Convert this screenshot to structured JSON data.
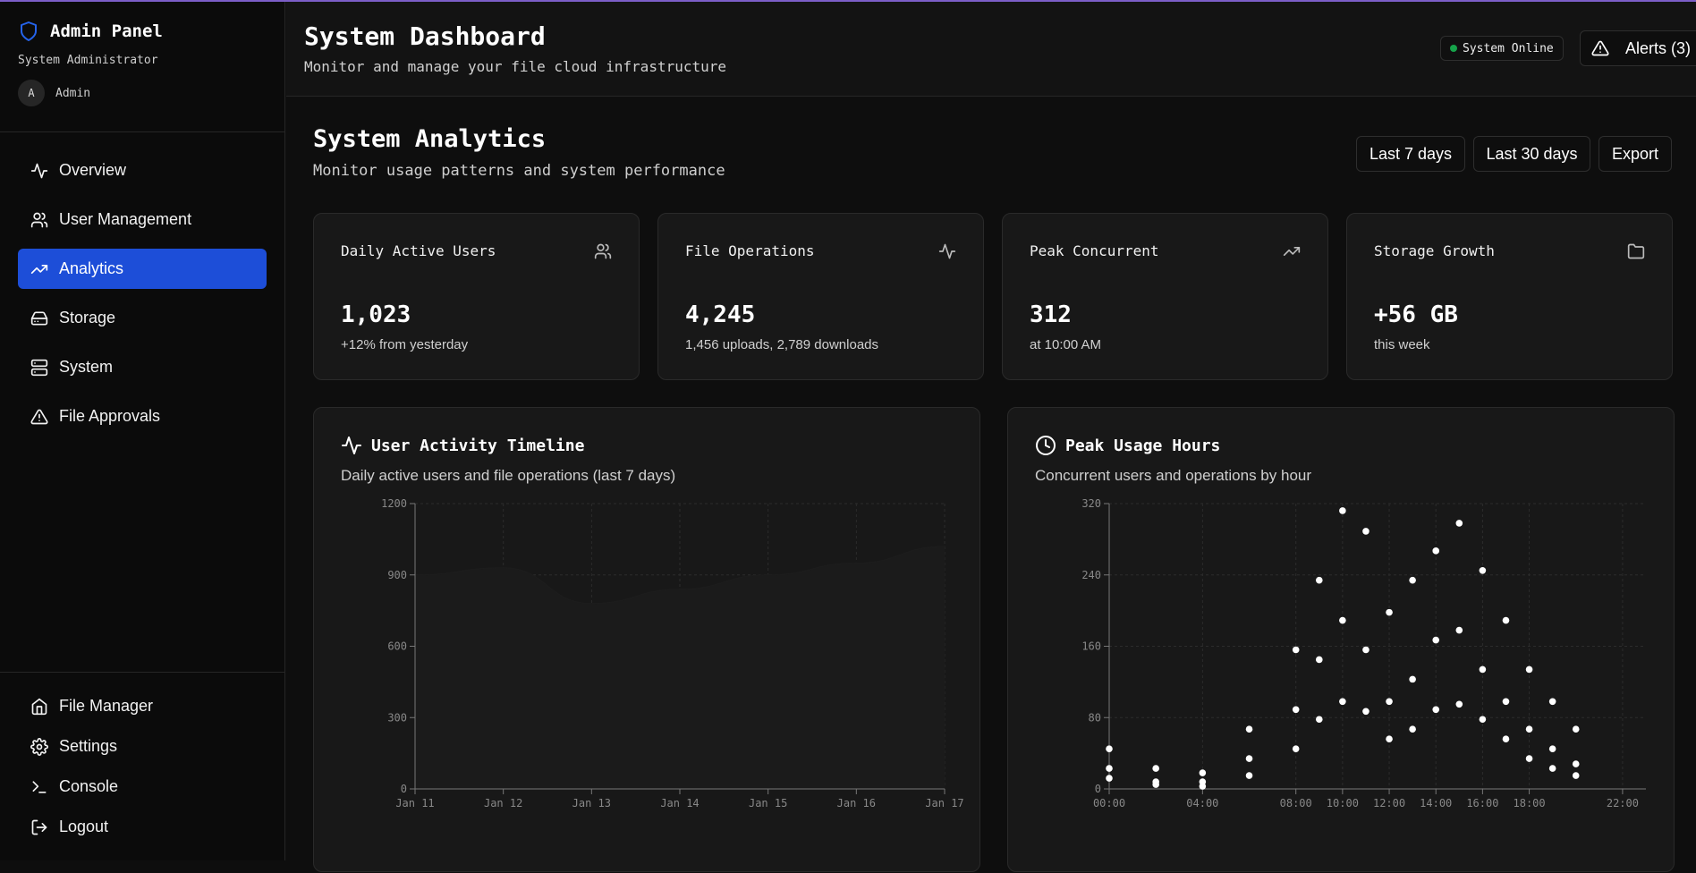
{
  "sidebar": {
    "brand_title": "Admin Panel",
    "brand_subtitle": "System Administrator",
    "avatar_initial": "A",
    "user_name": "Admin",
    "nav": [
      {
        "label": "Overview",
        "icon": "activity-icon"
      },
      {
        "label": "User Management",
        "icon": "users-icon"
      },
      {
        "label": "Analytics",
        "icon": "trending-up-icon",
        "active": true
      },
      {
        "label": "Storage",
        "icon": "hard-drive-icon"
      },
      {
        "label": "System",
        "icon": "server-icon"
      },
      {
        "label": "File Approvals",
        "icon": "alert-triangle-icon"
      }
    ],
    "bottom_nav": [
      {
        "label": "File Manager",
        "icon": "home-icon"
      },
      {
        "label": "Settings",
        "icon": "gear-icon"
      },
      {
        "label": "Console",
        "icon": "terminal-icon"
      },
      {
        "label": "Logout",
        "icon": "logout-icon"
      }
    ]
  },
  "header": {
    "title": "System Dashboard",
    "subtitle": "Monitor and manage your file cloud infrastructure",
    "status": "System Online",
    "alerts_label": "Alerts (3)"
  },
  "analytics": {
    "title": "System Analytics",
    "subtitle": "Monitor usage patterns and system performance",
    "buttons": {
      "last7": "Last 7 days",
      "last30": "Last 30 days",
      "export": "Export"
    }
  },
  "stats": [
    {
      "title": "Daily Active Users",
      "value": "1,023",
      "note": "+12% from yesterday",
      "icon": "users-icon"
    },
    {
      "title": "File Operations",
      "value": "4,245",
      "note": "1,456 uploads, 2,789 downloads",
      "icon": "activity-icon"
    },
    {
      "title": "Peak Concurrent",
      "value": "312",
      "note": "at 10:00 AM",
      "icon": "trending-up-icon"
    },
    {
      "title": "Storage Growth",
      "value": "+56 GB",
      "note": "this week",
      "icon": "folder-icon"
    }
  ],
  "colors": {
    "accent": "#1d4ed8",
    "online": "#16a34a",
    "top_border": "#7c5ec7"
  },
  "chart_data": [
    {
      "type": "area",
      "title": "User Activity Timeline",
      "subtitle": "Daily active users and file operations (last 7 days)",
      "categories": [
        "Jan 11",
        "Jan 12",
        "Jan 13",
        "Jan 14",
        "Jan 15",
        "Jan 16",
        "Jan 17"
      ],
      "series": [
        {
          "values": [
            900,
            930,
            780,
            840,
            900,
            950,
            1020
          ]
        }
      ],
      "ylim": [
        0,
        1200
      ],
      "yticks": [
        0,
        300,
        600,
        900,
        1200
      ],
      "grid": true
    },
    {
      "type": "scatter",
      "title": "Peak Usage Hours",
      "subtitle": "Concurrent users and operations by hour",
      "xticks": [
        "00:00",
        "04:00",
        "08:00",
        "10:00",
        "12:00",
        "14:00",
        "16:00",
        "18:00",
        "22:00"
      ],
      "xlim": [
        0,
        23
      ],
      "ylim": [
        0,
        320
      ],
      "yticks": [
        0,
        80,
        160,
        240,
        320
      ],
      "grid": true,
      "points": [
        [
          0,
          45
        ],
        [
          0,
          23
        ],
        [
          0,
          12
        ],
        [
          2,
          23
        ],
        [
          2,
          8
        ],
        [
          2,
          5
        ],
        [
          4,
          18
        ],
        [
          4,
          8
        ],
        [
          4,
          3
        ],
        [
          6,
          67
        ],
        [
          6,
          34
        ],
        [
          6,
          15
        ],
        [
          8,
          156
        ],
        [
          8,
          89
        ],
        [
          8,
          45
        ],
        [
          9,
          234
        ],
        [
          9,
          145
        ],
        [
          9,
          78
        ],
        [
          10,
          312
        ],
        [
          10,
          189
        ],
        [
          10,
          98
        ],
        [
          11,
          289
        ],
        [
          11,
          156
        ],
        [
          11,
          87
        ],
        [
          12,
          198
        ],
        [
          12,
          98
        ],
        [
          12,
          56
        ],
        [
          13,
          234
        ],
        [
          13,
          123
        ],
        [
          13,
          67
        ],
        [
          14,
          267
        ],
        [
          14,
          167
        ],
        [
          14,
          89
        ],
        [
          15,
          298
        ],
        [
          15,
          178
        ],
        [
          15,
          95
        ],
        [
          16,
          245
        ],
        [
          16,
          134
        ],
        [
          16,
          78
        ],
        [
          17,
          189
        ],
        [
          17,
          98
        ],
        [
          17,
          56
        ],
        [
          18,
          134
        ],
        [
          18,
          67
        ],
        [
          18,
          34
        ],
        [
          19,
          98
        ],
        [
          19,
          45
        ],
        [
          19,
          23
        ],
        [
          20,
          67
        ],
        [
          20,
          28
        ],
        [
          20,
          15
        ]
      ]
    }
  ]
}
